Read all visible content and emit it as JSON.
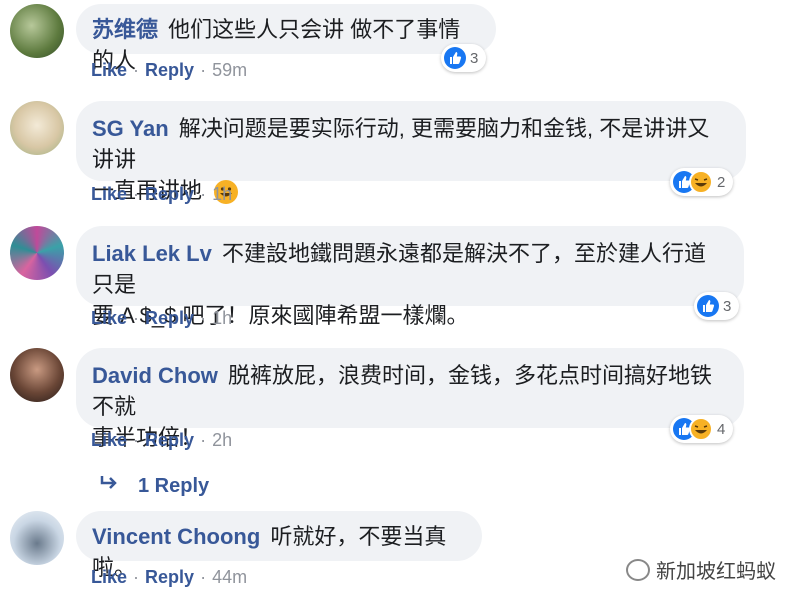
{
  "comments": [
    {
      "author": "苏维德",
      "text": "他们这些人只会讲 做不了事情的人",
      "actions": {
        "like": "Like",
        "reply": "Reply",
        "time": "59m"
      },
      "reactions": {
        "count": "3",
        "types": [
          "like-icon"
        ]
      }
    },
    {
      "author": "SG Yan",
      "text_line1": "解决问题是要实际行动, 更需要脑力和金钱, 不是讲讲又讲讲",
      "text_line2": "一直再讲地",
      "actions": {
        "like": "Like",
        "reply": "Reply",
        "time": "1h"
      },
      "reactions": {
        "count": "2",
        "types": [
          "like-icon",
          "haha-icon"
        ]
      }
    },
    {
      "author": "Liak Lek Lv",
      "text_line1": "不建設地鐵問題永遠都是解決不了，至於建人行道只是",
      "text_line2": "要 A $_$ 吧了！原來國陣希盟一樣爛。",
      "actions": {
        "like": "Like",
        "reply": "Reply",
        "time": "1h"
      },
      "reactions": {
        "count": "3",
        "types": [
          "like-icon"
        ]
      }
    },
    {
      "author": "David Chow",
      "text_line1": "脱裤放屁，浪费时间，金钱，多花点时间搞好地铁不就",
      "text_line2": "事半功倍！",
      "actions": {
        "like": "Like",
        "reply": "Reply",
        "time": "2h"
      },
      "reactions": {
        "count": "4",
        "types": [
          "like-icon",
          "haha-icon"
        ]
      },
      "replies_label": "1 Reply"
    },
    {
      "author": "Vincent Choong",
      "text": "听就好，不要当真啦。",
      "actions": {
        "like": "Like",
        "reply": "Reply",
        "time": "44m"
      }
    }
  ],
  "watermark": "新加坡红蚂蚁",
  "colors": {
    "link": "#385898",
    "bubble": "#f0f2f5",
    "like": "#1877f2",
    "haha": "#f7b125",
    "muted": "#90949c"
  }
}
